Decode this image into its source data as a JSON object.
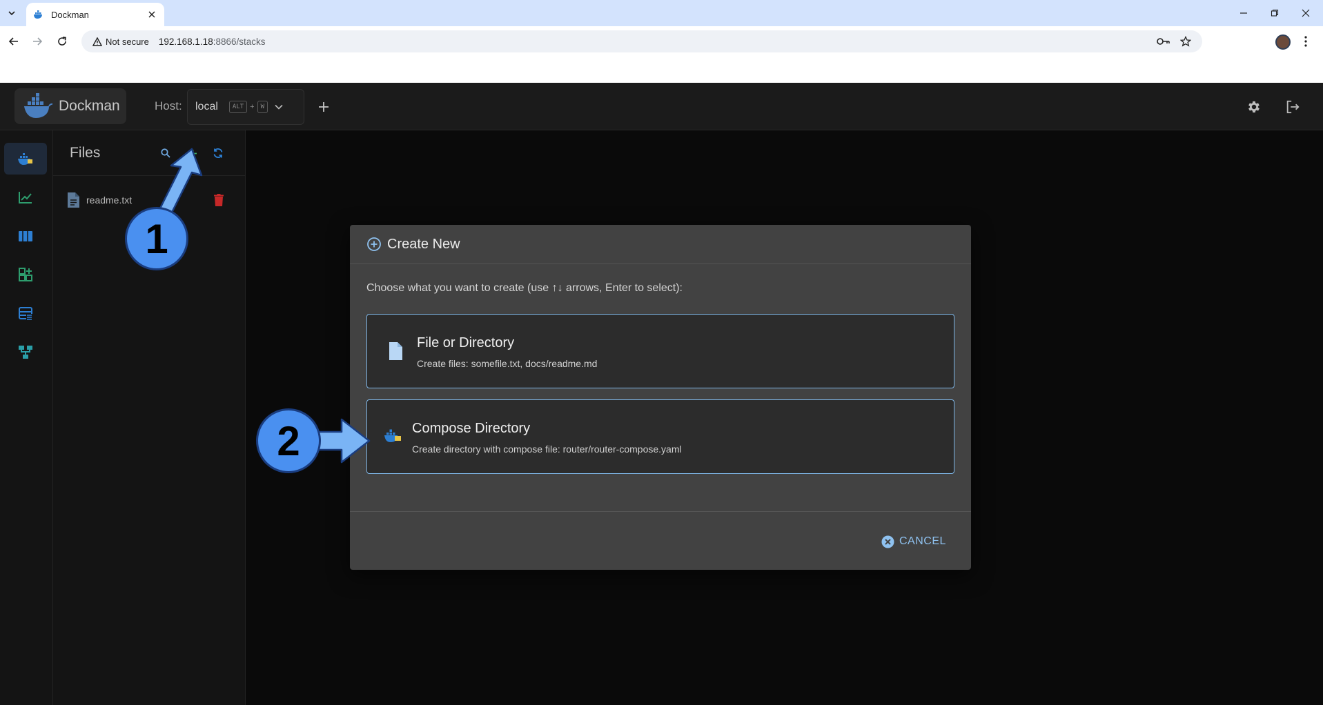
{
  "browser": {
    "tab_title": "Dockman",
    "security_label": "Not secure",
    "url_host": "192.168.1.18",
    "url_rest": ":8866/stacks"
  },
  "app": {
    "name": "Dockman",
    "host_label": "Host:",
    "host_value": "local",
    "shortcut_key1": "ALT",
    "shortcut_plus": "+",
    "shortcut_key2": "W"
  },
  "files": {
    "title": "Files",
    "items": [
      {
        "name": "readme.txt"
      }
    ]
  },
  "dialog": {
    "title": "Create New",
    "prompt": "Choose what you want to create (use ↑↓ arrows, Enter to select):",
    "options": [
      {
        "title": "File or Directory",
        "subtitle": "Create files: somefile.txt, docs/readme.md"
      },
      {
        "title": "Compose Directory",
        "subtitle": "Create directory with compose file: router/router-compose.yaml"
      }
    ],
    "cancel_label": "CANCEL"
  },
  "callouts": [
    {
      "number": "1"
    },
    {
      "number": "2"
    }
  ],
  "colors": {
    "accent": "#8fc2f0",
    "callout_fill": "#4a90f0",
    "delete_red": "#c62828",
    "rail_green": "#2e9e6e",
    "rail_blue": "#2d7fd3"
  }
}
